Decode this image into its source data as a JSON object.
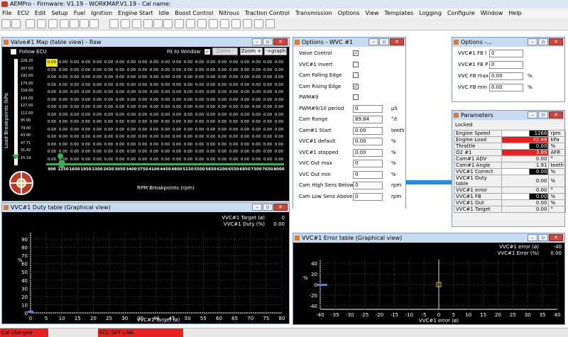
{
  "app": {
    "title": "AEMPro - Firmware: V1.19 - WORKMAP.V1.19 - Cal name:"
  },
  "menu": [
    "File",
    "ECU",
    "Edit",
    "Setup",
    "Fuel",
    "Ignition",
    "Engine Start",
    "Idle",
    "Boost Control",
    "Nitrous",
    "Traction Control",
    "Transmission",
    "Options",
    "View",
    "Templates",
    "Logging",
    "Configure",
    "Window",
    "Help"
  ],
  "valve_map": {
    "title": "Valve#1 Map (table view) - Raw",
    "follow_ecu": "Follow ECU",
    "fit_to_window": "Fit to Window",
    "zoom_minus": "Zoom -",
    "zoom_plus": "Zoom +",
    "graph_btn": "->graph",
    "y_axis_label": "Load Breakpoints (kPa",
    "x_axis_label": "RPM Breakpoints (rpm)",
    "rpm": [
      "900",
      "1250",
      "1600",
      "1950",
      "2300",
      "2650",
      "3050",
      "3400",
      "3750",
      "4100",
      "4450",
      "4800",
      "5150",
      "5500",
      "5850",
      "6200",
      "6550",
      "6950",
      "7300",
      "7650",
      "8000"
    ],
    "load": [
      "226.20",
      "207.00",
      "191.00",
      "175.00",
      "159.00",
      "143.00",
      "127.00",
      "111.00",
      "95.00",
      "79.00",
      "63.00",
      "47.71",
      "31.42",
      "15.19"
    ],
    "cell_value": "0.00",
    "highlight_cell": "0.00"
  },
  "options_vvc": {
    "title": "Options - WVC #1",
    "rows": [
      {
        "label": "Valve Control",
        "type": "check",
        "checked": "✓"
      },
      {
        "label": "VVC#1 invert",
        "type": "check",
        "checked": ""
      },
      {
        "label": "Cam Falling Edge",
        "type": "check",
        "checked": ""
      },
      {
        "label": "Cam Rising Edge",
        "type": "check",
        "checked": "✓"
      },
      {
        "label": "PWM#9",
        "type": "check",
        "checked": ""
      },
      {
        "label": "PWM#9/10 period",
        "type": "input",
        "value": "0",
        "unit": "µS"
      },
      {
        "label": "Cam Range",
        "type": "input",
        "value": "89.84",
        "unit": "°/t"
      },
      {
        "label": "Cam#1 Start",
        "type": "input",
        "value": "0.00",
        "unit": "teeth"
      },
      {
        "label": "VVC#1 default",
        "type": "input",
        "value": "0.00",
        "unit": "%"
      },
      {
        "label": "VVC#1 stopped",
        "type": "input",
        "value": "0.00",
        "unit": "%"
      },
      {
        "label": "VVC Out max",
        "type": "input",
        "value": "0",
        "unit": "%"
      },
      {
        "label": "VVC Out min",
        "type": "input",
        "value": "0",
        "unit": "%"
      },
      {
        "label": "Cam High Sens Below",
        "type": "input",
        "value": "0",
        "unit": "rpm"
      },
      {
        "label": "Cam Low Sens Above",
        "type": "input",
        "value": "0",
        "unit": "rpm"
      }
    ]
  },
  "options_small": {
    "title": "Options -...",
    "rows": [
      {
        "label": "VVC#1 FB I",
        "value": "0",
        "unit": ""
      },
      {
        "label": "VVC#1 FB P",
        "value": "0",
        "unit": ""
      },
      {
        "label": "VVC FB max",
        "value": "0.00",
        "unit": "%"
      },
      {
        "label": "VVC FB min",
        "value": "0.00",
        "unit": "%"
      }
    ]
  },
  "parameters": {
    "title": "Parameters",
    "locked": "Locked",
    "rows": [
      {
        "name": "Engine Speed",
        "value": "1266",
        "unit": "rpm",
        "style": "white"
      },
      {
        "name": "Engine Load",
        "value": "42.48",
        "unit": "kPa",
        "style": "red"
      },
      {
        "name": "Throttle",
        "value": "0.00",
        "unit": "%",
        "style": "white"
      },
      {
        "name": "O2 #1",
        "value": "3.89",
        "unit": "AFR",
        "style": "red"
      },
      {
        "name": "Cam#1 ADV",
        "value": "0.00",
        "unit": "°",
        "style": "plain"
      },
      {
        "name": "Cam#1 Angle",
        "value": "1.91",
        "unit": "teeth",
        "style": "plain"
      },
      {
        "name": "VVC#1 Correct",
        "value": "0.00",
        "unit": "%",
        "style": "white"
      },
      {
        "name": "VVC#1 Duty table",
        "value": "0.00",
        "unit": "%",
        "style": "plain"
      },
      {
        "name": "VVC#1 error",
        "value": "0.00",
        "unit": "°",
        "style": "plain"
      },
      {
        "name": "VVC#1 FB",
        "value": "0.00",
        "unit": "%",
        "style": "white"
      },
      {
        "name": "VVC#1 Out",
        "value": "0.00",
        "unit": "%",
        "style": "plain"
      },
      {
        "name": "VVC#1 Target",
        "value": "0.00",
        "unit": "°",
        "style": "plain"
      }
    ]
  },
  "duty_graph": {
    "title": "VVC#1 Duty table (Graphical view)",
    "legend": [
      {
        "label": "VVC#1 Target (ø)",
        "value": "0"
      },
      {
        "label": "VVC#1 Duty (%)",
        "value": "0.00"
      }
    ],
    "y_ticks": [
      "90",
      "80",
      "70",
      "60",
      "50",
      "40",
      "30",
      "20",
      "10",
      "0"
    ],
    "y_label": "%",
    "x_ticks": [
      "0",
      "5",
      "10",
      "15",
      "20",
      "25",
      "30",
      "35",
      "40",
      "45",
      "50",
      "55",
      "60",
      "65",
      "70",
      "75",
      "80"
    ],
    "x_label": "VVC#1 Target (ø)"
  },
  "error_graph": {
    "title": "VVC#1 Error table (Graphical view)",
    "legend": [
      {
        "label": "VVC#1 error (ø)",
        "value": "-40"
      },
      {
        "label": "VVC#1 Error (%)",
        "value": "0.00"
      }
    ],
    "y_ticks": [
      "40",
      "20",
      "0",
      "-20",
      "-40"
    ],
    "y_label": "%",
    "x_ticks": [
      "-40",
      "-35",
      "-30",
      "-25",
      "-20",
      "-15",
      "-10",
      "-5",
      "0",
      "5",
      "10",
      "15",
      "20",
      "25",
      "30",
      "35",
      "40"
    ],
    "x_label": "VVC#1 error (ø)"
  },
  "status": {
    "cal": "Cal changed",
    "ecu": "ECU OFF LINE"
  }
}
